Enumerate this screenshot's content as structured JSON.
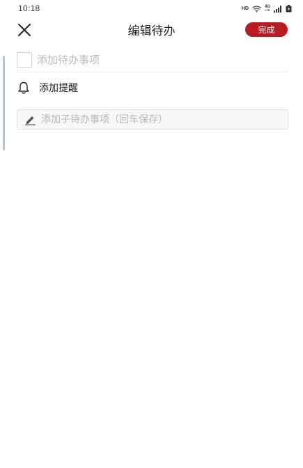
{
  "status_bar": {
    "time": "10:18",
    "hd": "HD",
    "network_top": "4G",
    "network_bottom": "LTE",
    "icons": [
      "wifi-icon",
      "signal-icon",
      "battery-icon"
    ]
  },
  "header": {
    "title": "编辑待办",
    "close_icon": "close-icon",
    "done_label": "完成"
  },
  "task": {
    "placeholder": "添加待办事项",
    "value": ""
  },
  "reminder": {
    "icon": "bell-icon",
    "label": "添加提醒"
  },
  "subtask": {
    "icon": "pencil-icon",
    "placeholder": "添加子待办事项（回车保存）",
    "value": ""
  },
  "colors": {
    "accent": "#b71c22",
    "placeholder": "#b8b8b8",
    "scroll_indicator": "#b5c4d2"
  }
}
